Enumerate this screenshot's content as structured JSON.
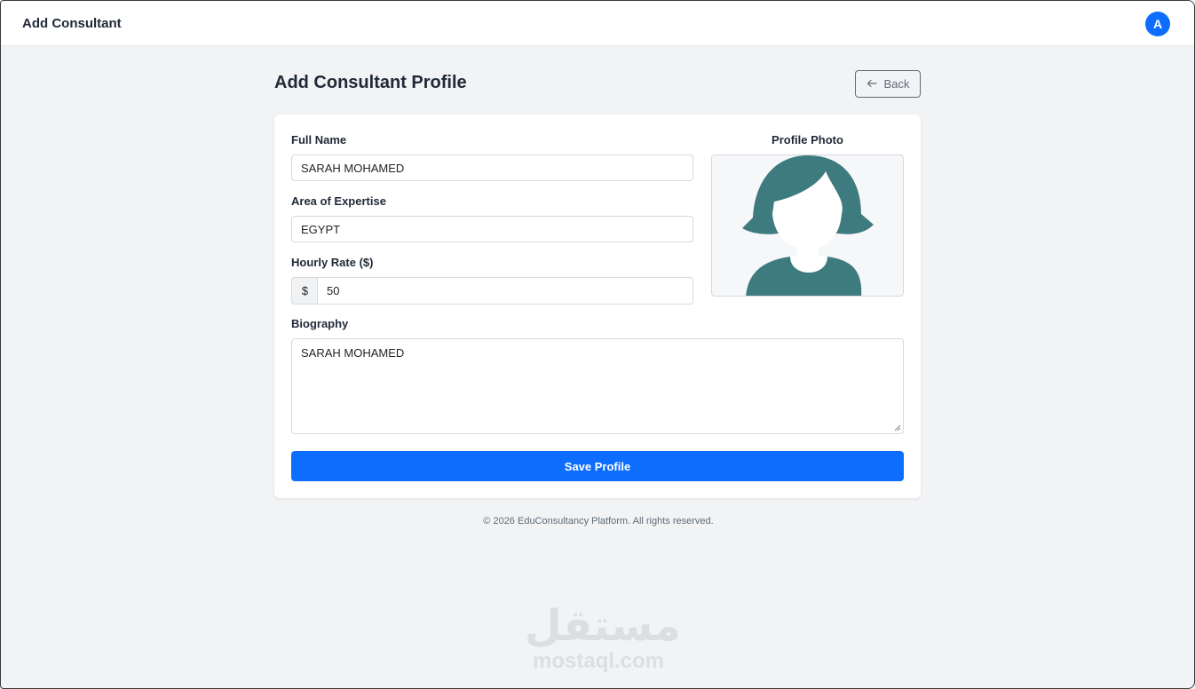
{
  "app": {
    "title": "Add Consultant",
    "avatar_initial": "A",
    "accent_color": "#0d6efd"
  },
  "page": {
    "heading": "Add Consultant Profile",
    "back_label": "Back",
    "back_icon": "arrow-left-icon"
  },
  "form": {
    "full_name": {
      "label": "Full Name",
      "value": "SARAH MOHAMED"
    },
    "expertise": {
      "label": "Area of Expertise",
      "value": "EGYPT"
    },
    "hourly_rate": {
      "label": "Hourly Rate ($)",
      "prefix": "$",
      "value": "50"
    },
    "biography": {
      "label": "Biography",
      "value": "SARAH MOHAMED"
    },
    "photo": {
      "label": "Profile Photo",
      "icon": "female-avatar-placeholder-icon"
    },
    "save_label": "Save Profile"
  },
  "footer": {
    "text": "© 2026 EduConsultancy Platform. All rights reserved."
  },
  "watermark": {
    "arabic": "مستقل",
    "latin": "mostaql.com"
  }
}
